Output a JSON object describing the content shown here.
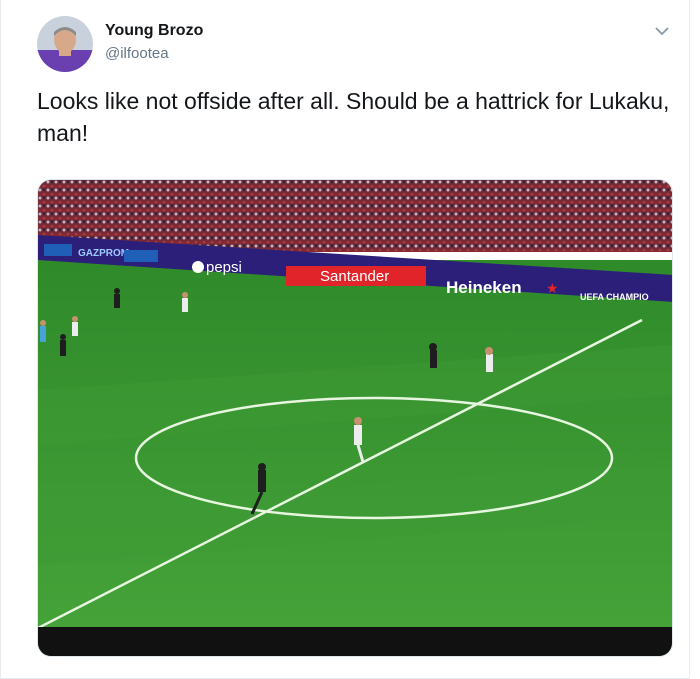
{
  "tweet": {
    "display_name": "Young Brozo",
    "handle": "@ilfootea",
    "text": "Looks like not offside after all. Should be a hattrick for Lukaku, man!",
    "caret_icon": "chevron-down-icon"
  },
  "media": {
    "boards": {
      "gazprom": "GAZPROM",
      "pepsi": "pepsi",
      "santander": "Santander",
      "heineken": "Heineken",
      "ucl": "UEFA CHAMPIO"
    }
  },
  "colors": {
    "text": "#14171a",
    "muted": "#657786",
    "pitch": "#3c8d2e",
    "board": "#2b1f7a"
  }
}
